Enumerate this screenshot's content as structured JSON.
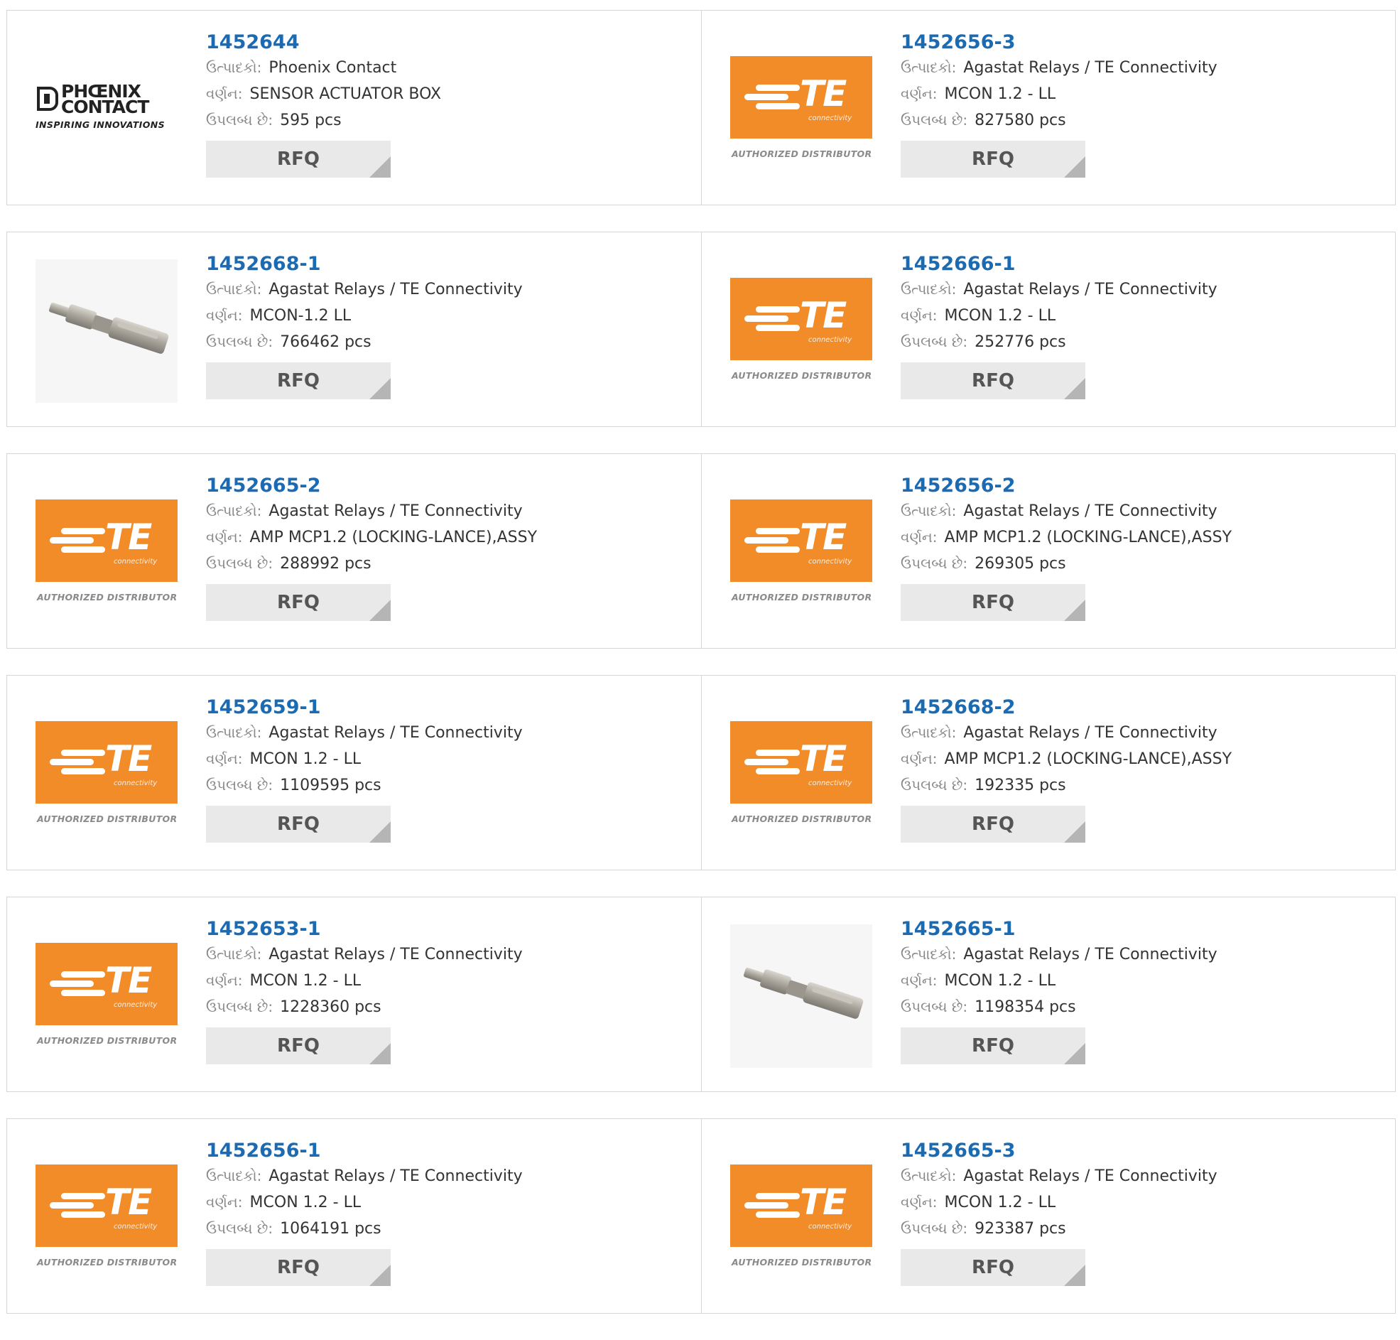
{
  "labels": {
    "manufacturer": "ઉત્પાદકો:",
    "description": "વર્ણન:",
    "available": "ઉપલબ્ધ છે:",
    "rfq": "RFQ"
  },
  "logos": {
    "te": {
      "brand": "TE",
      "sub": "connectivity",
      "tagline": "AUTHORIZED DISTRIBUTOR",
      "color": "#f28c28"
    },
    "phoenix": {
      "line1": "PHŒNIX",
      "line2": "CONTACT",
      "tagline": "INSPIRING INNOVATIONS"
    }
  },
  "products": [
    {
      "part": "1452644",
      "manufacturer": "Phoenix Contact",
      "description": "SENSOR ACTUATOR BOX",
      "stock": "595 pcs",
      "image": "phoenix-logo"
    },
    {
      "part": "1452656-3",
      "manufacturer": "Agastat Relays / TE Connectivity",
      "description": "MCON 1.2 - LL",
      "stock": "827580 pcs",
      "image": "te-logo"
    },
    {
      "part": "1452668-1",
      "manufacturer": "Agastat Relays / TE Connectivity",
      "description": "MCON-1.2 LL",
      "stock": "766462 pcs",
      "image": "part-photo"
    },
    {
      "part": "1452666-1",
      "manufacturer": "Agastat Relays / TE Connectivity",
      "description": "MCON 1.2 - LL",
      "stock": "252776 pcs",
      "image": "te-logo"
    },
    {
      "part": "1452665-2",
      "manufacturer": "Agastat Relays / TE Connectivity",
      "description": "AMP MCP1.2 (LOCKING-LANCE),ASSY",
      "stock": "288992 pcs",
      "image": "te-logo"
    },
    {
      "part": "1452656-2",
      "manufacturer": "Agastat Relays / TE Connectivity",
      "description": "AMP MCP1.2 (LOCKING-LANCE),ASSY",
      "stock": "269305 pcs",
      "image": "te-logo"
    },
    {
      "part": "1452659-1",
      "manufacturer": "Agastat Relays / TE Connectivity",
      "description": "MCON 1.2 - LL",
      "stock": "1109595 pcs",
      "image": "te-logo"
    },
    {
      "part": "1452668-2",
      "manufacturer": "Agastat Relays / TE Connectivity",
      "description": "AMP MCP1.2 (LOCKING-LANCE),ASSY",
      "stock": "192335 pcs",
      "image": "te-logo"
    },
    {
      "part": "1452653-1",
      "manufacturer": "Agastat Relays / TE Connectivity",
      "description": "MCON 1.2 - LL",
      "stock": "1228360 pcs",
      "image": "te-logo"
    },
    {
      "part": "1452665-1",
      "manufacturer": "Agastat Relays / TE Connectivity",
      "description": "MCON 1.2 - LL",
      "stock": "1198354 pcs",
      "image": "part-photo"
    },
    {
      "part": "1452656-1",
      "manufacturer": "Agastat Relays / TE Connectivity",
      "description": "MCON 1.2 - LL",
      "stock": "1064191 pcs",
      "image": "te-logo"
    },
    {
      "part": "1452665-3",
      "manufacturer": "Agastat Relays / TE Connectivity",
      "description": "MCON 1.2 - LL",
      "stock": "923387 pcs",
      "image": "te-logo"
    }
  ]
}
